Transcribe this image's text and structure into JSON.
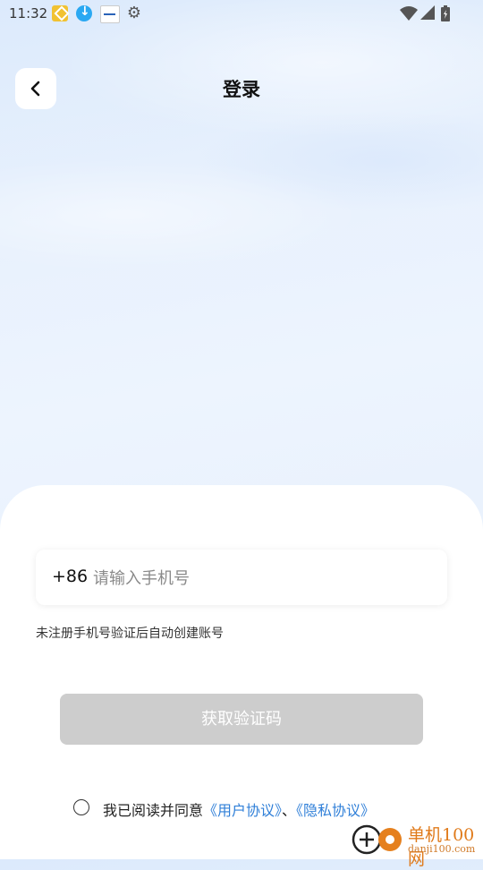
{
  "status_bar": {
    "time": "11:32",
    "icons": [
      "app-icon",
      "download-icon",
      "app-icon",
      "gear-icon",
      "wifi-icon",
      "signal-icon",
      "battery-icon"
    ]
  },
  "header": {
    "title": "登录",
    "back_icon": "chevron-left-icon"
  },
  "form": {
    "country_code": "+86",
    "phone_placeholder": "请输入手机号",
    "phone_value": "",
    "hint": "未注册手机号验证后自动创建账号",
    "get_code_label": "获取验证码"
  },
  "agreement": {
    "checked": false,
    "prefix": "我已阅读并同意",
    "user_agreement": "《用户协议》",
    "separator": "、",
    "privacy_policy": "《隐私协议》"
  },
  "watermark": {
    "title": "单机100网",
    "domain": "danji100.com"
  },
  "colors": {
    "accent_link": "#2f7fd8",
    "button_disabled": "#cdcdcd",
    "background_top": "#dceafc"
  }
}
